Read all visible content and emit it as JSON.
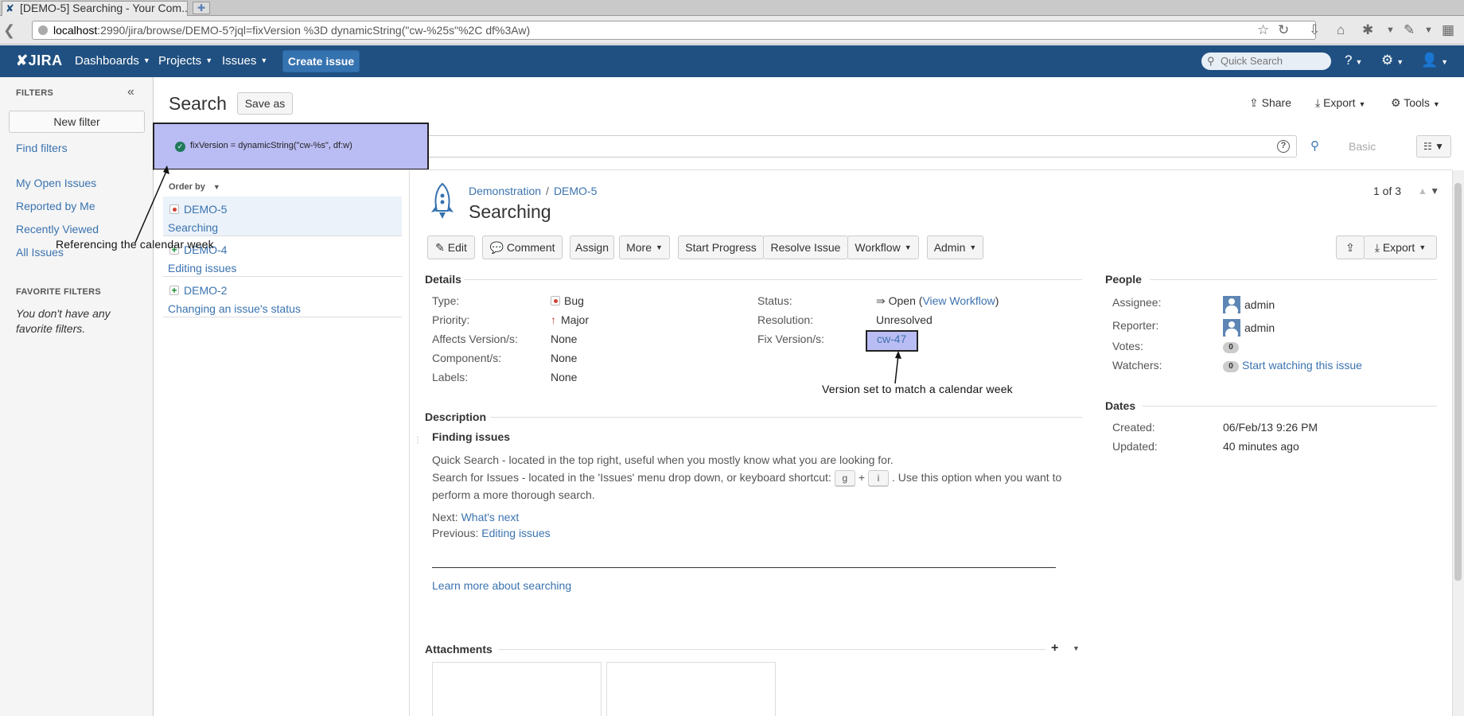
{
  "browser": {
    "tab_title": "[DEMO-5] Searching - Your Com...",
    "url_host": "localhost",
    "url_rest": ":2990/jira/browse/DEMO-5?jql=fixVersion %3D dynamicString(\"cw-%25s\"%2C df%3Aw)"
  },
  "header": {
    "logo": "JIRA",
    "nav": [
      "Dashboards",
      "Projects",
      "Issues"
    ],
    "create_label": "Create issue",
    "search_placeholder": "Quick Search"
  },
  "sidebar": {
    "filters_heading": "FILTERS",
    "new_filter": "New filter",
    "find_filters": "Find filters",
    "links": [
      "My Open Issues",
      "Reported by Me",
      "Recently Viewed",
      "All Issues"
    ],
    "favorite_heading": "FAVORITE FILTERS",
    "no_favorites": "You don't have any favorite filters."
  },
  "search": {
    "title": "Search",
    "save_as": "Save as",
    "share": "Share",
    "export": "Export",
    "tools": "Tools",
    "jql": "fixVersion = dynamicString(\"cw-%s\", df:w)",
    "basic": "Basic",
    "order_by": "Order by"
  },
  "issue_list": [
    {
      "key": "DEMO-5",
      "summary": "Searching",
      "type": "bug"
    },
    {
      "key": "DEMO-4",
      "summary": "Editing issues",
      "type": "new-feature"
    },
    {
      "key": "DEMO-2",
      "summary": "Changing an issue's status",
      "type": "new-feature"
    }
  ],
  "annotations": {
    "calendar_week": "Referencing the calendar week",
    "version_match": "Version set to match a calendar week"
  },
  "issue": {
    "project": "Demonstration",
    "key": "DEMO-5",
    "summary": "Searching",
    "pager": "1 of 3",
    "actions": {
      "edit": "Edit",
      "comment": "Comment",
      "assign": "Assign",
      "more": "More",
      "start_progress": "Start Progress",
      "resolve": "Resolve Issue",
      "workflow": "Workflow",
      "admin": "Admin",
      "export": "Export"
    },
    "details": {
      "heading": "Details",
      "type_label": "Type:",
      "type": "Bug",
      "priority_label": "Priority:",
      "priority": "Major",
      "affects_label": "Affects Version/s:",
      "affects": "None",
      "components_label": "Component/s:",
      "components": "None",
      "labels_label": "Labels:",
      "labels": "None",
      "status_label": "Status:",
      "status": "Open",
      "view_workflow": "View Workflow",
      "resolution_label": "Resolution:",
      "resolution": "Unresolved",
      "fix_label": "Fix Version/s:",
      "fix": "cw-47"
    },
    "description": {
      "heading": "Description",
      "title": "Finding issues",
      "line1": "Quick Search - located in the top right, useful when you mostly know what you are looking for.",
      "line2a": "Search for Issues - located in the 'Issues' menu drop down, or keyboard shortcut:",
      "key_g": "g",
      "plus": "+",
      "key_i": "i",
      "line2b": ". Use this option when you want to",
      "line3": "perform a more thorough search.",
      "next_label": "Next:",
      "next_link": "What's next",
      "prev_label": "Previous:",
      "prev_link": "Editing issues",
      "learn_more": "Learn more about searching"
    },
    "attachments_heading": "Attachments",
    "people": {
      "heading": "People",
      "assignee_label": "Assignee:",
      "assignee": "admin",
      "reporter_label": "Reporter:",
      "reporter": "admin",
      "votes_label": "Votes:",
      "votes": "0",
      "watchers_label": "Watchers:",
      "watchers": "0",
      "watch_link": "Start watching this issue"
    },
    "dates": {
      "heading": "Dates",
      "created_label": "Created:",
      "created": "06/Feb/13 9:26 PM",
      "updated_label": "Updated:",
      "updated": "40 minutes ago"
    }
  }
}
